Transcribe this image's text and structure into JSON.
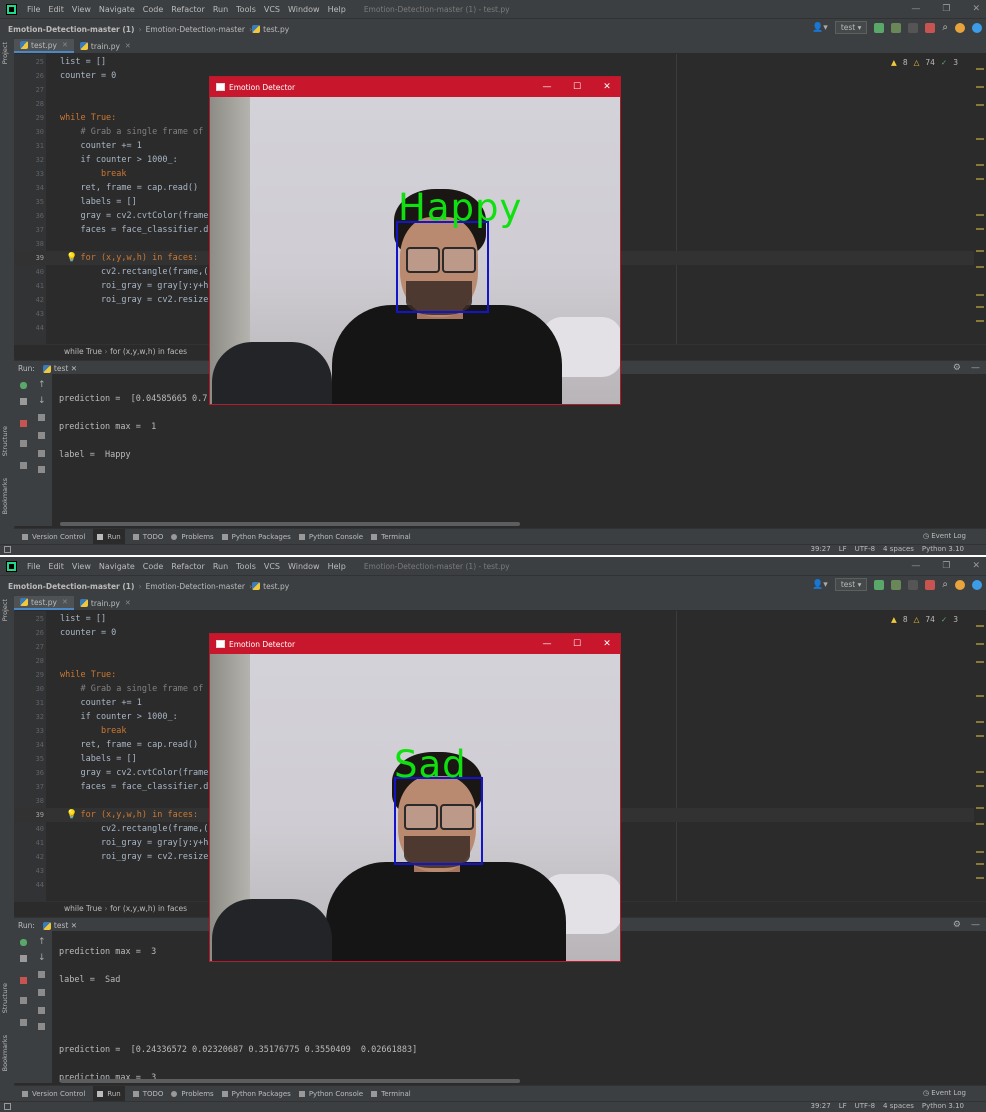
{
  "menu": [
    "File",
    "Edit",
    "View",
    "Navigate",
    "Code",
    "Refactor",
    "Run",
    "Tools",
    "VCS",
    "Window",
    "Help"
  ],
  "window_title": "Emotion-Detection-master (1) - test.py",
  "breadcrumb": {
    "project": "Emotion-Detection-master (1)",
    "folder": "Emotion-Detection-master",
    "file": "test.py"
  },
  "run_config": "test",
  "tabs": [
    {
      "label": "test.py"
    },
    {
      "label": "train.py"
    }
  ],
  "inspections": {
    "warnings": "8",
    "weak_warnings": "74",
    "ok": "3"
  },
  "code": {
    "lines": [
      {
        "n": "25",
        "t": "list = []"
      },
      {
        "n": "26",
        "t": "counter = 0"
      },
      {
        "n": "27",
        "t": ""
      },
      {
        "n": "28",
        "t": ""
      },
      {
        "n": "29",
        "t": "while True:"
      },
      {
        "n": "30",
        "t": "    # Grab a single frame of"
      },
      {
        "n": "31",
        "t": "    counter += 1"
      },
      {
        "n": "32",
        "t": "    if counter > 1000_:"
      },
      {
        "n": "33",
        "t": "        break"
      },
      {
        "n": "34",
        "t": "    ret, frame = cap.read()"
      },
      {
        "n": "35",
        "t": "    labels = []"
      },
      {
        "n": "36",
        "t": "    gray = cv2.cvtColor(frame"
      },
      {
        "n": "37",
        "t": "    faces = face_classifier.d"
      },
      {
        "n": "38",
        "t": ""
      },
      {
        "n": "39",
        "t": "    for (x,y,w,h) in faces:"
      },
      {
        "n": "40",
        "t": "        cv2.rectangle(frame,("
      },
      {
        "n": "41",
        "t": "        roi_gray = gray[y:y+h"
      },
      {
        "n": "42",
        "t": "        roi_gray = cv2.resize"
      },
      {
        "n": "43",
        "t": ""
      },
      {
        "n": "44",
        "t": ""
      }
    ]
  },
  "editor_breadcrumb": {
    "a": "while True",
    "b": "for (x,y,w,h) in faces"
  },
  "run_panel": {
    "label": "Run:",
    "tab": "test"
  },
  "console": {
    "top": [
      "prediction =  [0.04585665 0.7",
      "prediction max =  1",
      "label =  Happy"
    ],
    "bottom": [
      "prediction max =  3",
      "label =  Sad",
      "prediction =  [0.24336572 0.02320687 0.35176775 0.3550409  0.02661883]",
      "prediction max =  3"
    ]
  },
  "tool_windows": [
    "Version Control",
    "Run",
    "TODO",
    "Problems",
    "Python Packages",
    "Python Console",
    "Terminal"
  ],
  "event_log": "Event Log",
  "status": {
    "position": "39:27",
    "line_sep": "LF",
    "encoding": "UTF-8",
    "indent": "4 spaces",
    "interpreter": "Python 3.10"
  },
  "emotion_window": {
    "title": "Emotion Detector",
    "minimize": "—",
    "maximize": "☐",
    "close": "✕"
  },
  "detections": {
    "top_label": "Happy",
    "bottom_label": "Sad"
  },
  "side_labels": {
    "project": "Project",
    "structure": "Structure",
    "bookmarks": "Bookmarks"
  },
  "colors": {
    "emotion_label": "#10e010",
    "face_box": "#1414c8",
    "title_bar": "#c8172c"
  }
}
